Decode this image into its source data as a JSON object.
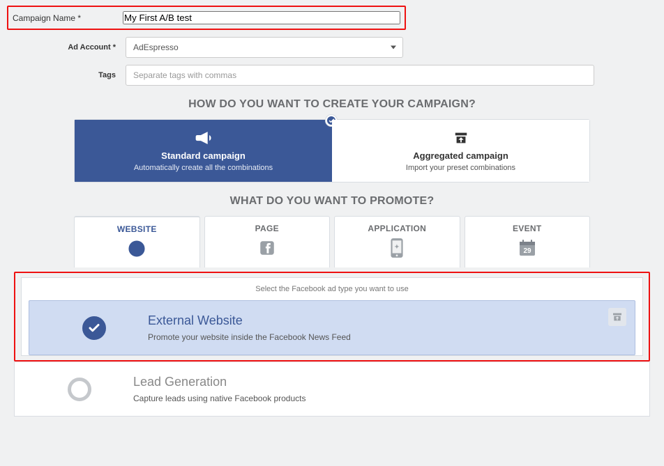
{
  "form": {
    "campaign_name": {
      "label": "Campaign Name *",
      "value": "My First A/B test"
    },
    "ad_account": {
      "label": "Ad Account *",
      "value": "AdEspresso"
    },
    "tags": {
      "label": "Tags",
      "placeholder": "Separate tags with commas"
    }
  },
  "sections": {
    "create_heading": "HOW DO YOU WANT TO CREATE YOUR CAMPAIGN?",
    "promote_heading": "WHAT DO YOU WANT TO PROMOTE?"
  },
  "campaign_type": {
    "standard": {
      "title": "Standard campaign",
      "subtitle": "Automatically create all the combinations"
    },
    "aggregated": {
      "title": "Aggregated campaign",
      "subtitle": "Import your preset combinations"
    }
  },
  "promote_tabs": {
    "website": "WEBSITE",
    "page": "PAGE",
    "application": "APPLICATION",
    "event": "EVENT",
    "event_day": "29"
  },
  "adtype": {
    "hint": "Select the Facebook ad type you want to use",
    "external_website": {
      "title": "External Website",
      "desc": "Promote your website inside the Facebook News Feed"
    },
    "lead_generation": {
      "title": "Lead Generation",
      "desc": "Capture leads using native Facebook products"
    }
  },
  "colors": {
    "brand": "#3b5897",
    "highlight_border": "#e11"
  }
}
